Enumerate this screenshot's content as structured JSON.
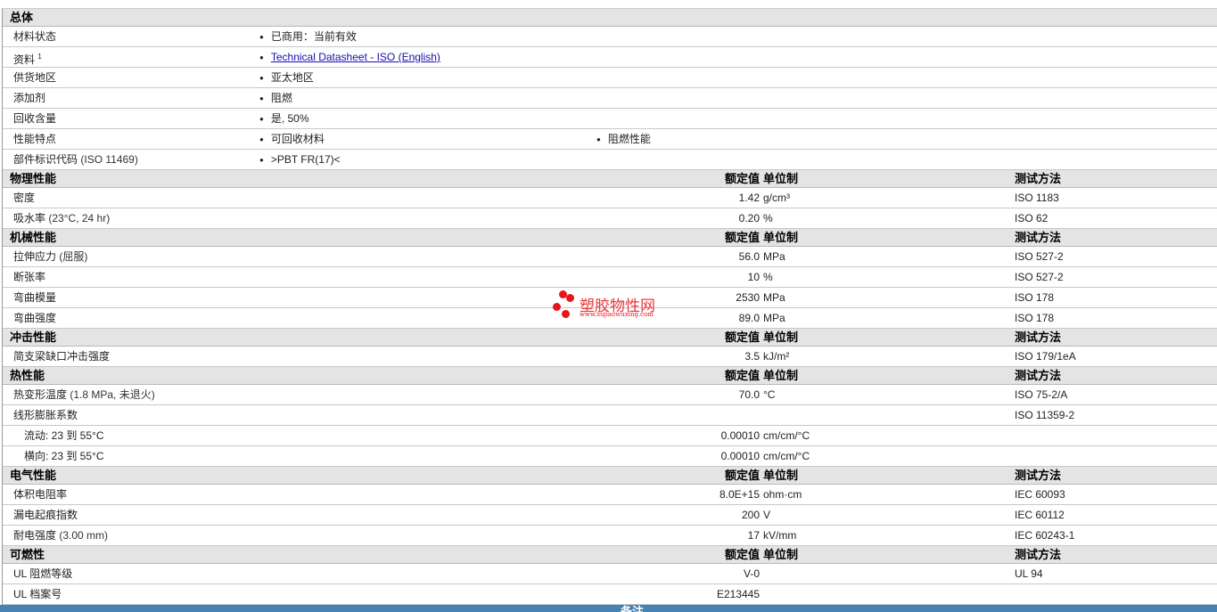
{
  "col_headers": {
    "value": "额定值",
    "unit": "单位制",
    "test": "测试方法"
  },
  "sections": [
    {
      "title": "总体",
      "type": "general",
      "rows": [
        {
          "label": "材料状态",
          "items": [
            "已商用：当前有效"
          ]
        },
        {
          "label": "资料",
          "sup": "1",
          "items": [
            "Technical Datasheet - ISO (English)"
          ],
          "link": true
        },
        {
          "label": "供货地区",
          "items": [
            "亚太地区"
          ]
        },
        {
          "label": "添加剂",
          "items": [
            "阻燃"
          ]
        },
        {
          "label": "回收含量",
          "items": [
            "是, 50%"
          ]
        },
        {
          "label": "性能特点",
          "items": [
            "可回收材料",
            "阻燃性能"
          ]
        },
        {
          "label": "部件标识代码",
          "paren": "(ISO 11469)",
          "items": [
            ">PBT FR(17)<"
          ]
        }
      ]
    },
    {
      "title": "物理性能",
      "rows": [
        {
          "label": "密度",
          "value": "1.42",
          "unit": "g/cm³",
          "test": "ISO 1183"
        },
        {
          "label": "吸水率",
          "paren": "(23°C, 24 hr)",
          "value": "0.20",
          "unit": "%",
          "test": "ISO 62"
        }
      ]
    },
    {
      "title": "机械性能",
      "rows": [
        {
          "label": "拉伸应力",
          "paren": "(屈服)",
          "value": "56.0",
          "unit": "MPa",
          "test": "ISO 527-2"
        },
        {
          "label": "断张率",
          "value": "10",
          "unit": "%",
          "test": "ISO 527-2"
        },
        {
          "label": "弯曲模量",
          "value": "2530",
          "unit": "MPa",
          "test": "ISO 178"
        },
        {
          "label": "弯曲强度",
          "value": "89.0",
          "unit": "MPa",
          "test": "ISO 178"
        }
      ]
    },
    {
      "title": "冲击性能",
      "rows": [
        {
          "label": "简支梁缺口冲击强度",
          "value": "3.5",
          "unit": "kJ/m²",
          "test": "ISO 179/1eA"
        }
      ]
    },
    {
      "title": "热性能",
      "rows": [
        {
          "label": "热变形温度",
          "paren": "(1.8 MPa, 未退火)",
          "value": "70.0",
          "unit": "°C",
          "test": "ISO 75-2/A"
        },
        {
          "label": "线形膨胀系数",
          "test": "ISO 11359-2"
        },
        {
          "label": "流动: 23 到  55°C",
          "sub": true,
          "value": "0.00010",
          "unit": "cm/cm/°C"
        },
        {
          "label": "横向: 23 到  55°C",
          "sub": true,
          "value": "0.00010",
          "unit": "cm/cm/°C"
        }
      ]
    },
    {
      "title": "电气性能",
      "rows": [
        {
          "label": "体积电阻率",
          "value": "8.0E+15",
          "unit": "ohm·cm",
          "test": "IEC 60093"
        },
        {
          "label": "漏电起痕指数",
          "value": "200",
          "unit": "V",
          "test": "IEC 60112"
        },
        {
          "label": "耐电强度",
          "paren": "(3.00 mm)",
          "value": "17",
          "unit": "kV/mm",
          "test": "IEC 60243-1"
        }
      ]
    },
    {
      "title": "可燃性",
      "rows": [
        {
          "label": "UL 阻燃等级",
          "value": "V-0",
          "test": "UL 94"
        },
        {
          "label": "UL 档案号",
          "value": "E213445"
        }
      ]
    }
  ],
  "footer": {
    "title": "备注"
  },
  "watermark": {
    "name": "塑胶物性网",
    "url": "www.sujiaowuxing.com"
  }
}
